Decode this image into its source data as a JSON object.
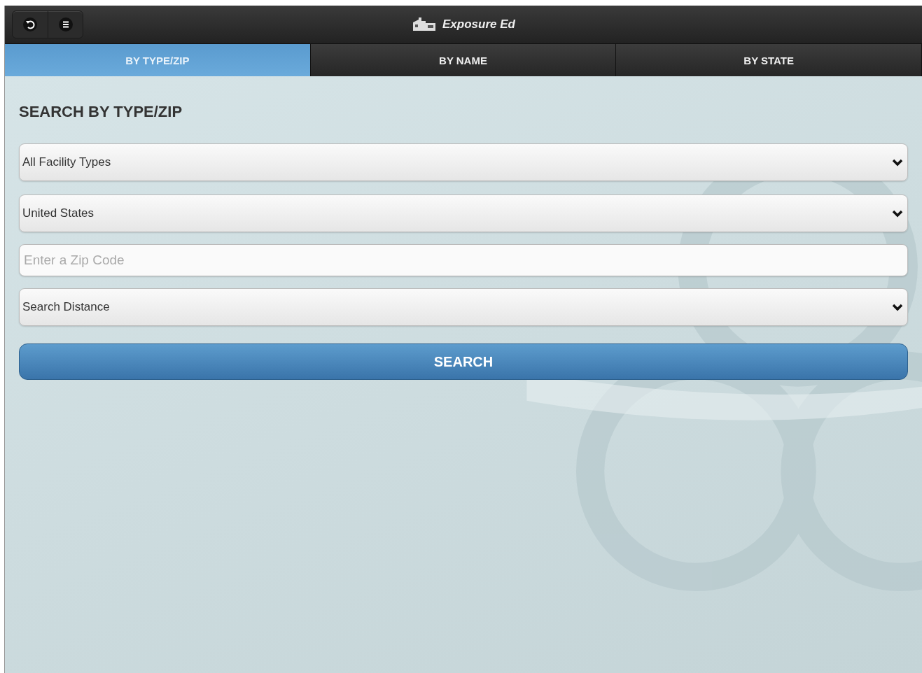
{
  "header": {
    "title": "Exposure Ed"
  },
  "tabs": [
    {
      "label": "BY TYPE/ZIP",
      "selected": true
    },
    {
      "label": "BY NAME",
      "selected": false
    },
    {
      "label": "BY STATE",
      "selected": false
    }
  ],
  "form": {
    "heading": "SEARCH BY TYPE/ZIP",
    "fields": [
      {
        "kind": "select",
        "value": "All Facility Types"
      },
      {
        "kind": "select",
        "value": "United States"
      },
      {
        "kind": "input",
        "placeholder": "Enter a Zip Code"
      },
      {
        "kind": "select",
        "value": "Search Distance"
      }
    ],
    "button": "SEARCH"
  }
}
